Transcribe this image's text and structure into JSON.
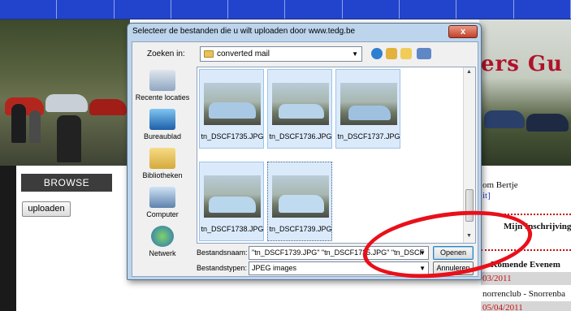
{
  "dialog": {
    "title": "Selecteer de bestanden die u wilt uploaden door www.tedg.be",
    "close_glyph": "x",
    "look_in_label": "Zoeken in:",
    "look_in_value": "converted mail",
    "places": [
      {
        "label": "Recente locaties",
        "icon": "recent-places-icon"
      },
      {
        "label": "Bureaublad",
        "icon": "desktop-icon"
      },
      {
        "label": "Bibliotheken",
        "icon": "libraries-icon"
      },
      {
        "label": "Computer",
        "icon": "computer-icon"
      },
      {
        "label": "Netwerk",
        "icon": "network-icon"
      }
    ],
    "files": [
      {
        "name": "tn_DSCF1735.JPG",
        "selected": true
      },
      {
        "name": "tn_DSCF1736.JPG",
        "selected": true
      },
      {
        "name": "tn_DSCF1737.JPG",
        "selected": true
      },
      {
        "name": "tn_DSCF1738.JPG",
        "selected": true
      },
      {
        "name": "tn_DSCF1739.JPG",
        "selected": true,
        "focused": true
      }
    ],
    "filename_label": "Bestandsnaam:",
    "filename_value": "\"tn_DSCF1739.JPG\" \"tn_DSCF1735.JPG\" \"tn_DSCF",
    "filetype_label": "Bestandstypen:",
    "filetype_value": "JPEG images",
    "open_button": "Openen",
    "cancel_button": "Annuleren"
  },
  "page": {
    "browse_label": "BROWSE",
    "upload_label": "uploaden",
    "banner_title": "ers Gu",
    "welcome_text": "om Bertje",
    "welcome_link": "it]",
    "registration_text": "Mijn Inschrijving",
    "events_heading": "Komende Evenem",
    "event_1_date": "03/2011",
    "event_1_name": "norrenclub - Snorrenba",
    "event_2_date": "05/04/2011"
  },
  "colors": {
    "nav_blue": "#2244cc",
    "annotation_red": "#e8101a",
    "selection_blue": "#dbeafa"
  }
}
